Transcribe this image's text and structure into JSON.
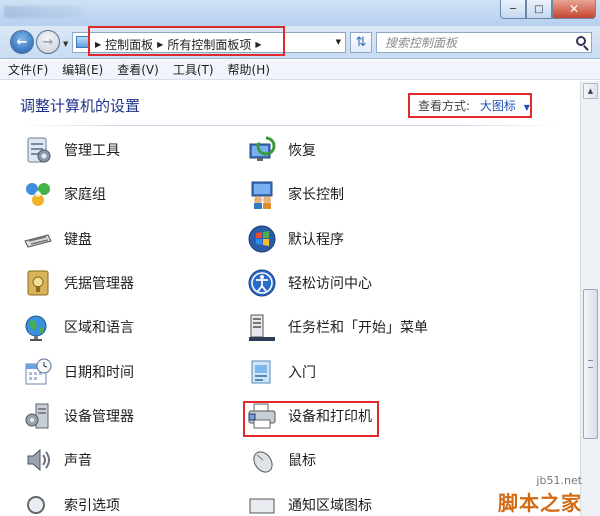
{
  "addressbar": {
    "crumbs": [
      "控制面板",
      "所有控制面板项"
    ],
    "search_placeholder": "搜索控制面板"
  },
  "menu": [
    "文件(F)",
    "编辑(E)",
    "查看(V)",
    "工具(T)",
    "帮助(H)"
  ],
  "content": {
    "title": "调整计算机的设置",
    "view_by_label": "查看方式:",
    "view_by_value": "大图标"
  },
  "items_left": [
    {
      "label": "管理工具",
      "icon": "admin-tools-icon"
    },
    {
      "label": "家庭组",
      "icon": "homegroup-icon"
    },
    {
      "label": "键盘",
      "icon": "keyboard-icon"
    },
    {
      "label": "凭据管理器",
      "icon": "credential-manager-icon"
    },
    {
      "label": "区域和语言",
      "icon": "region-language-icon"
    },
    {
      "label": "日期和时间",
      "icon": "date-time-icon"
    },
    {
      "label": "设备管理器",
      "icon": "device-manager-icon"
    },
    {
      "label": "声音",
      "icon": "sound-icon"
    },
    {
      "label": "索引选项",
      "icon": "indexing-options-icon"
    }
  ],
  "items_right": [
    {
      "label": "恢复",
      "icon": "recovery-icon"
    },
    {
      "label": "家长控制",
      "icon": "parental-controls-icon"
    },
    {
      "label": "默认程序",
      "icon": "default-programs-icon"
    },
    {
      "label": "轻松访问中心",
      "icon": "ease-of-access-icon"
    },
    {
      "label": "任务栏和「开始」菜单",
      "icon": "taskbar-start-icon"
    },
    {
      "label": "入门",
      "icon": "getting-started-icon"
    },
    {
      "label": "设备和打印机",
      "icon": "devices-printers-icon"
    },
    {
      "label": "鼠标",
      "icon": "mouse-icon"
    },
    {
      "label": "通知区域图标",
      "icon": "notification-icons-icon"
    }
  ],
  "watermark": {
    "site": "jb51.net",
    "brand": "脚本之家"
  },
  "colors": {
    "highlight": "#e22a2a",
    "title": "#1e3287",
    "link": "#1e50b4"
  }
}
